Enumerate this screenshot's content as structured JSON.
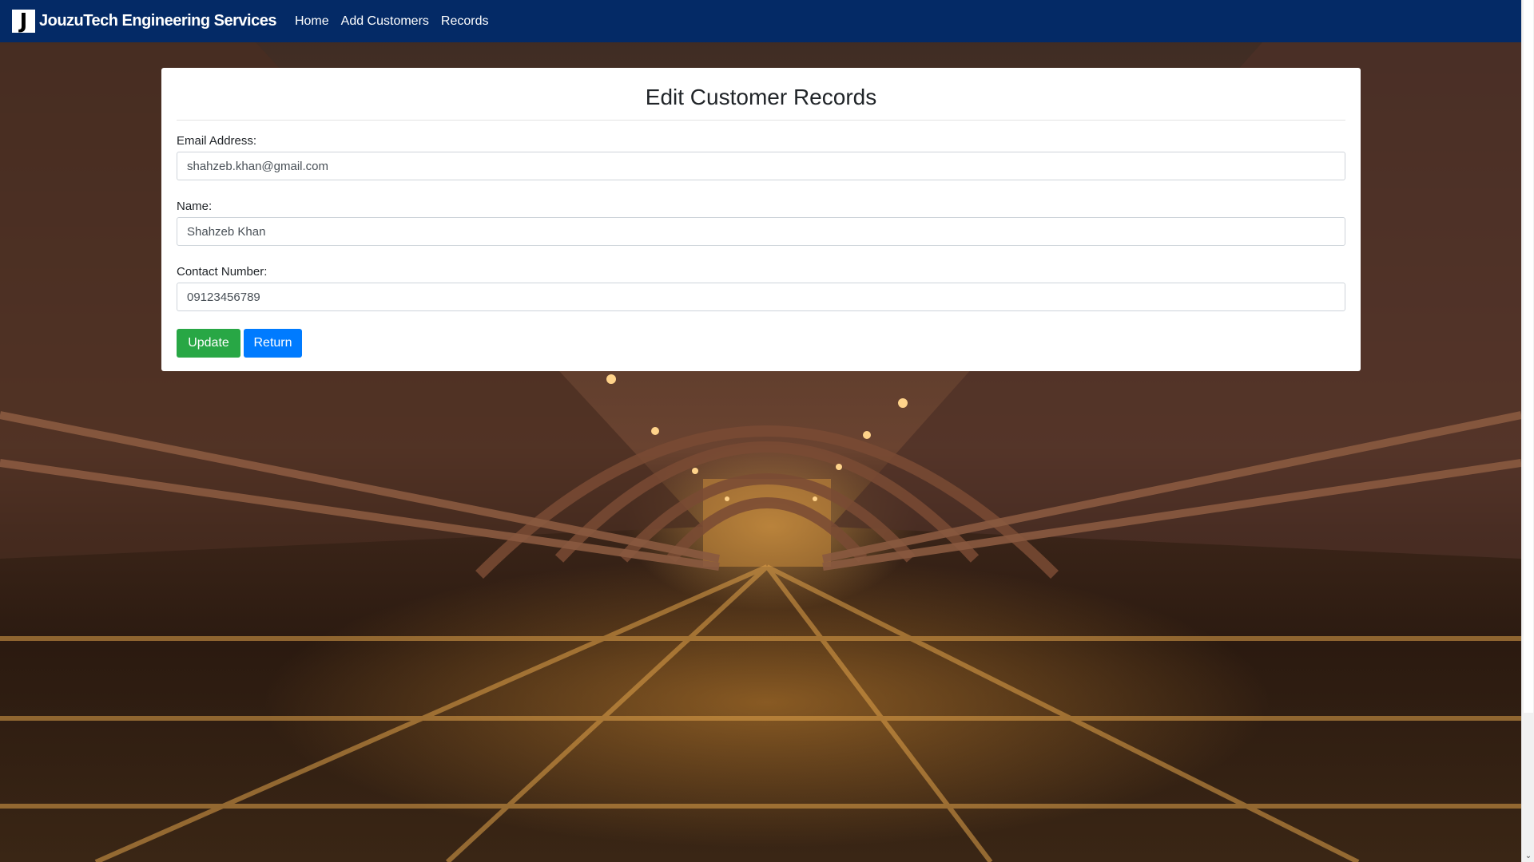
{
  "navbar": {
    "logo_letter": "J",
    "brand": "JouzuTech Engineering Services",
    "links": [
      "Home",
      "Add Customers",
      "Records"
    ],
    "background": "#042a66"
  },
  "form": {
    "title": "Edit Customer Records",
    "fields": {
      "email": {
        "label": "Email Address:",
        "value": "shahzeb.khan@gmail.com"
      },
      "name": {
        "label": "Name:",
        "value": "Shahzeb Khan"
      },
      "contact": {
        "label": "Contact Number:",
        "value": "09123456789"
      }
    },
    "buttons": {
      "update": "Update",
      "return": "Return"
    }
  },
  "colors": {
    "update_button": "#28a745",
    "return_button": "#007bff"
  },
  "background": {
    "icon": "steel-bridge-photo"
  },
  "scrollbar": {
    "icon": "chevron-down-icon",
    "glyph": "⌄"
  }
}
